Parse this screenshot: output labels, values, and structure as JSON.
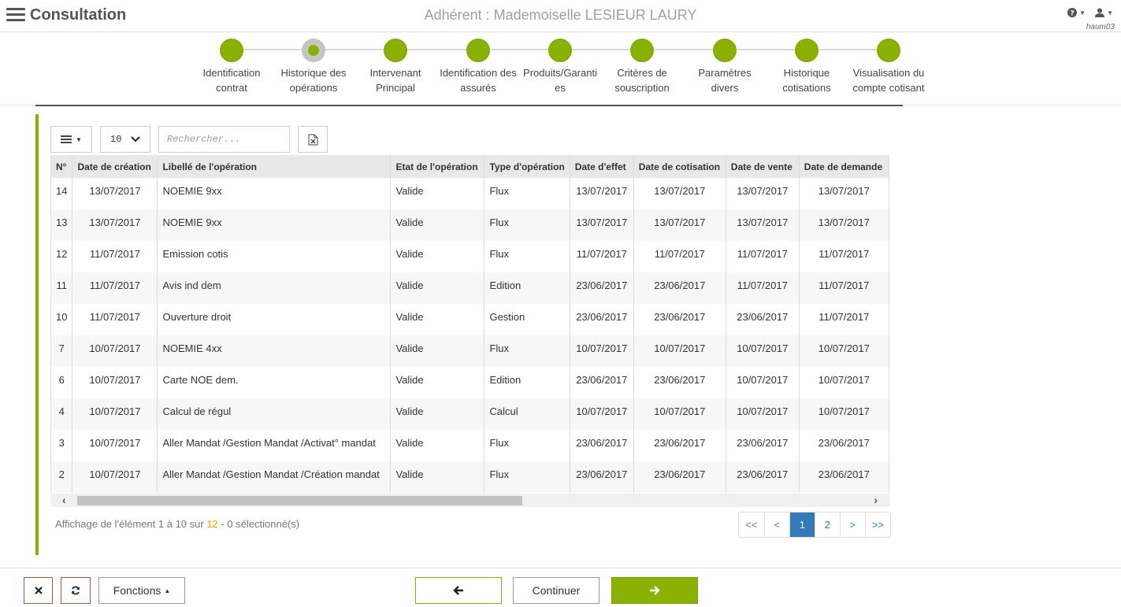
{
  "header": {
    "app_title": "Consultation",
    "adherent": "Adhérent : Mademoiselle LESIEUR LAURY",
    "username": "haum03"
  },
  "stepper": {
    "steps": [
      {
        "line1": "Identification",
        "line2": "contrat"
      },
      {
        "line1": "Historique des",
        "line2": "opérations"
      },
      {
        "line1": "Intervenant",
        "line2": "Principal"
      },
      {
        "line1": "Identification des",
        "line2": "assurés"
      },
      {
        "line1": "Produits/Garanti",
        "line2": "es"
      },
      {
        "line1": "Critères de",
        "line2": "souscription"
      },
      {
        "line1": "Paramètres",
        "line2": "divers"
      },
      {
        "line1": "Historique",
        "line2": "cotisations"
      },
      {
        "line1": "Visualisation du",
        "line2": "compte cotisant"
      }
    ],
    "current_index": 1
  },
  "toolbar": {
    "page_size": "10",
    "search_placeholder": "Rechercher..."
  },
  "table": {
    "headers": [
      "N°",
      "Date de création",
      "Libellé de l'opération",
      "Etat de l'opération",
      "Type d'opération",
      "Date d'effet",
      "Date de cotisation",
      "Date de vente",
      "Date de demande"
    ],
    "rows": [
      [
        "14",
        "13/07/2017",
        "NOEMIE 9xx",
        "Valide",
        "Flux",
        "13/07/2017",
        "13/07/2017",
        "13/07/2017",
        "13/07/2017"
      ],
      [
        "13",
        "13/07/2017",
        "NOEMIE 9xx",
        "Valide",
        "Flux",
        "13/07/2017",
        "13/07/2017",
        "13/07/2017",
        "13/07/2017"
      ],
      [
        "12",
        "11/07/2017",
        "Emission cotis",
        "Valide",
        "Flux",
        "11/07/2017",
        "11/07/2017",
        "11/07/2017",
        "11/07/2017"
      ],
      [
        "11",
        "11/07/2017",
        "Avis ind dem",
        "Valide",
        "Edition",
        "23/06/2017",
        "23/06/2017",
        "11/07/2017",
        "11/07/2017"
      ],
      [
        "10",
        "11/07/2017",
        "Ouverture droit",
        "Valide",
        "Gestion",
        "23/06/2017",
        "23/06/2017",
        "23/06/2017",
        "11/07/2017"
      ],
      [
        "7",
        "10/07/2017",
        "NOEMIE 4xx",
        "Valide",
        "Flux",
        "10/07/2017",
        "10/07/2017",
        "10/07/2017",
        "10/07/2017"
      ],
      [
        "6",
        "10/07/2017",
        "Carte NOE dem.",
        "Valide",
        "Edition",
        "23/06/2017",
        "23/06/2017",
        "10/07/2017",
        "10/07/2017"
      ],
      [
        "4",
        "10/07/2017",
        "Calcul de régul",
        "Valide",
        "Calcul",
        "10/07/2017",
        "10/07/2017",
        "10/07/2017",
        "10/07/2017"
      ],
      [
        "3",
        "10/07/2017",
        "Aller Mandat /Gestion Mandat /Activat° mandat",
        "Valide",
        "Flux",
        "23/06/2017",
        "23/06/2017",
        "23/06/2017",
        "23/06/2017"
      ],
      [
        "2",
        "10/07/2017",
        "Aller Mandat /Gestion Mandat /Création mandat",
        "Valide",
        "Flux",
        "23/06/2017",
        "23/06/2017",
        "23/06/2017",
        "23/06/2017"
      ]
    ]
  },
  "info": {
    "prefix": "Affichage de l'élément 1 à 10 sur",
    "total": "12",
    "suffix": "- 0 sélectionné(s)"
  },
  "pagination": [
    "<<",
    "<",
    "1",
    "2",
    ">",
    ">>"
  ],
  "footer": {
    "fonctions_label": "Fonctions",
    "continuer_label": "Continuer"
  },
  "colors": {
    "accent_green": "#8ab000",
    "link_blue": "#337ab7",
    "close_border": "#b5523b"
  }
}
